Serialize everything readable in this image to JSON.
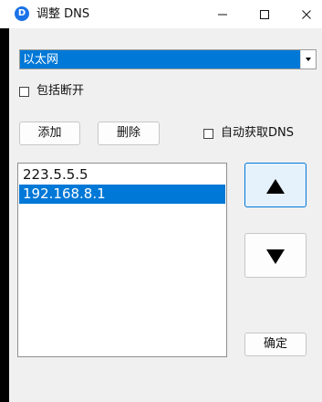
{
  "window": {
    "title": "调整 DNS",
    "app_icon_letter": "D",
    "controls": [
      "minimize-icon",
      "maximize-icon",
      "close-icon"
    ]
  },
  "adapter": {
    "selected": "以太网"
  },
  "options": {
    "include_disconnected_label": "包括断开",
    "include_disconnected_checked": false,
    "auto_dns_label": "自动获取DNS",
    "auto_dns_checked": false
  },
  "buttons": {
    "add": "添加",
    "delete": "删除",
    "ok": "确定",
    "move_up_icon": "arrow-up-icon",
    "move_down_icon": "arrow-down-icon"
  },
  "dns_list": {
    "items": [
      "223.5.5.5",
      "192.168.8.1"
    ],
    "selected_item": "192.168.8.1"
  },
  "colors": {
    "selection": "#0078d7",
    "window_bg": "#f0f0f0",
    "titlebar_bg": "#ffffff",
    "app_icon": "#1a73e8"
  }
}
